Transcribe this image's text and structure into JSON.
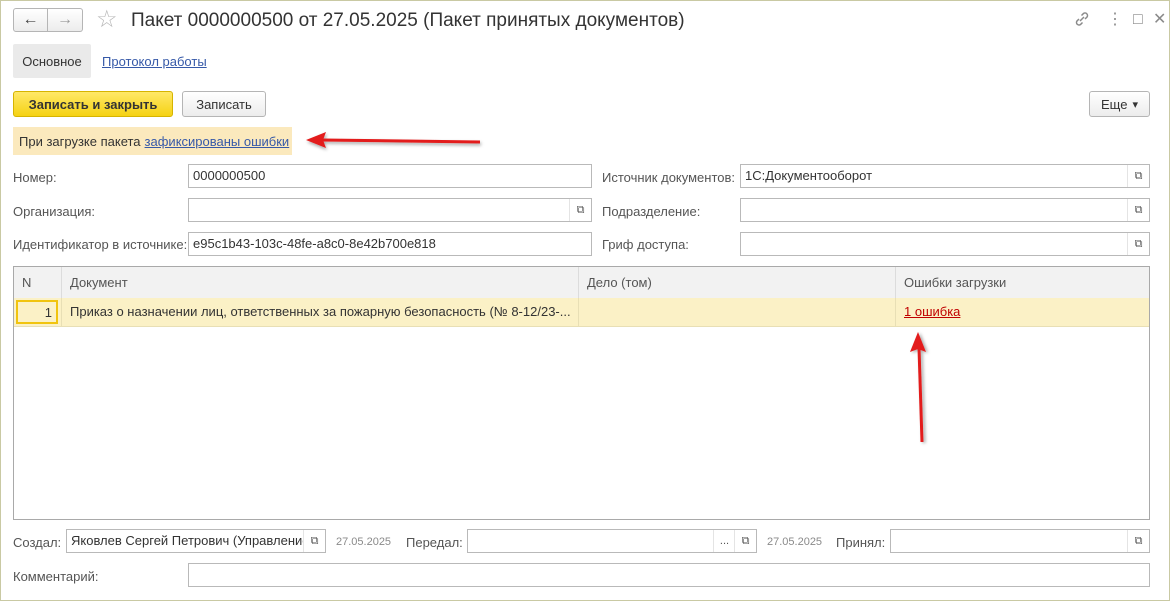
{
  "window": {
    "title": "Пакет 0000000500 от 27.05.2025 (Пакет принятых документов)",
    "back_icon": "←",
    "forward_icon": "→",
    "star_icon": "☆",
    "link_icon": "🔗",
    "menu_icon": "⋮",
    "maximize_icon": "□",
    "close_icon": "✕"
  },
  "tabs": {
    "main": "Основное",
    "protocol": "Протокол работы"
  },
  "toolbar": {
    "save_close": "Записать и закрыть",
    "save": "Записать",
    "more": "Еще",
    "more_arrow": "▾"
  },
  "notice": {
    "text": "При загрузке пакета",
    "link": "зафиксированы ошибки"
  },
  "form": {
    "number_label": "Номер:",
    "number_value": "0000000500",
    "org_label": "Организация:",
    "org_value": "",
    "source_id_label": "Идентификатор в источнике:",
    "source_id_value": "e95c1b43-103c-48fe-a8c0-8e42b700e818",
    "doc_source_label": "Источник документов:",
    "doc_source_value": "1С:Документооборот",
    "department_label": "Подразделение:",
    "department_value": "",
    "access_label": "Гриф доступа:",
    "access_value": ""
  },
  "table": {
    "columns": [
      "N",
      "Документ",
      "Дело (том)",
      "Ошибки загрузки"
    ],
    "rows": [
      {
        "n": "1",
        "document": "Приказ о назначении лиц, ответственных за пожарную безопасность (№ 8-12/23-...",
        "case": "",
        "errors": "1 ошибка"
      }
    ]
  },
  "footer": {
    "created_label": "Создал:",
    "created_value": "Яковлев Сергей Петрович (Управление",
    "created_date": "27.05.2025",
    "passed_label": "Передал:",
    "passed_value": "",
    "passed_date": "27.05.2025",
    "accepted_label": "Принял:",
    "accepted_value": "",
    "comment_label": "Комментарий:",
    "comment_value": ""
  },
  "icons": {
    "open_icon": "⧉",
    "ellipsis": "..."
  },
  "colors": {
    "primary_button": "#f5d213",
    "notice_bg": "#fbe9bd",
    "selected_row": "#fbf1c6",
    "link": "#3659a8",
    "error_link": "#c00000",
    "arrow": "#e31b1b"
  }
}
